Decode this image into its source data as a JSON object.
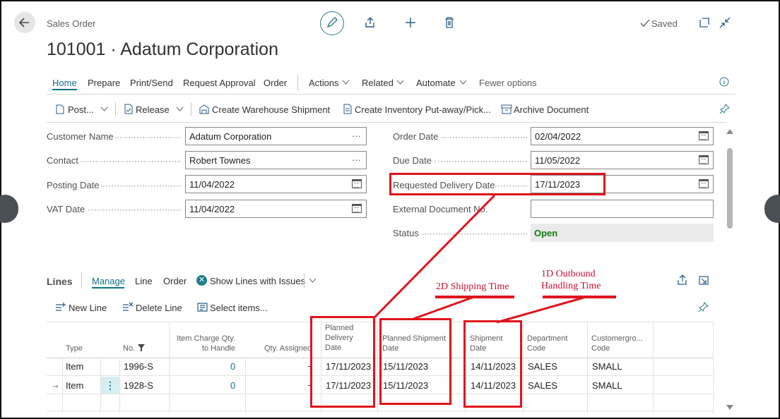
{
  "header": {
    "breadcrumb": "Sales Order",
    "title": "101001 · Adatum Corporation",
    "saved": "Saved"
  },
  "menu": {
    "home": "Home",
    "prepare": "Prepare",
    "print_send": "Print/Send",
    "request_approval": "Request Approval",
    "order": "Order",
    "actions": "Actions",
    "related": "Related",
    "automate": "Automate",
    "fewer_options": "Fewer options"
  },
  "actions": {
    "post": "Post...",
    "release": "Release",
    "create_warehouse_shipment": "Create Warehouse Shipment",
    "create_inventory": "Create Inventory Put-away/Pick...",
    "archive_document": "Archive Document"
  },
  "fields": {
    "customer_name_label": "Customer Name",
    "customer_name_value": "Adatum Corporation",
    "contact_label": "Contact",
    "contact_value": "Robert Townes",
    "posting_date_label": "Posting Date",
    "posting_date_value": "11/04/2022",
    "vat_date_label": "VAT Date",
    "vat_date_value": "11/04/2022",
    "order_date_label": "Order Date",
    "order_date_value": "02/04/2022",
    "due_date_label": "Due Date",
    "due_date_value": "11/05/2022",
    "requested_delivery_label": "Requested Delivery Date",
    "requested_delivery_value": "17/11/2023",
    "external_doc_label": "External Document No.",
    "external_doc_value": "",
    "status_label": "Status",
    "status_value": "Open"
  },
  "lines": {
    "title": "Lines",
    "tabs": {
      "manage": "Manage",
      "line": "Line",
      "order": "Order",
      "show_issues": "Show Lines with Issues"
    },
    "toolbar": {
      "new_line": "New Line",
      "delete_line": "Delete Line",
      "select_items": "Select items..."
    },
    "columns": {
      "type": "Type",
      "no": "No.",
      "item_charge_1": "Item Charge Qty.",
      "item_charge_2": "to Handle",
      "qty_assigned": "Qty. Assigned",
      "planned_delivery_1": "Planned",
      "planned_delivery_2": "Delivery",
      "planned_delivery_3": "Date",
      "planned_shipment_1": "Planned Shipment",
      "planned_shipment_2": "Date",
      "shipment_1": "Shipment",
      "shipment_2": "Date",
      "department_1": "Department",
      "department_2": "Code",
      "customergroup_1": "Customergro...",
      "customergroup_2": "Code"
    },
    "rows": [
      {
        "type": "Item",
        "no": "1996-S",
        "item_charge": "0",
        "planned_delivery": "17/11/2023",
        "planned_shipment": "15/11/2023",
        "shipment": "14/11/2023",
        "department": "SALES",
        "customergroup": "SMALL"
      },
      {
        "type": "Item",
        "no": "1928-S",
        "item_charge": "0",
        "planned_delivery": "17/11/2023",
        "planned_shipment": "15/11/2023",
        "shipment": "14/11/2023",
        "department": "SALES",
        "customergroup": "SMALL"
      }
    ]
  },
  "annotations": {
    "shipping_time": "2D Shipping Time",
    "outbound_1": "1D Outbound",
    "outbound_2": "Handling Time",
    "color": "#e0141c"
  },
  "colors": {
    "accent": "#0f6f8a",
    "status_green": "#107c10",
    "status_bg": "#eaeaea"
  }
}
